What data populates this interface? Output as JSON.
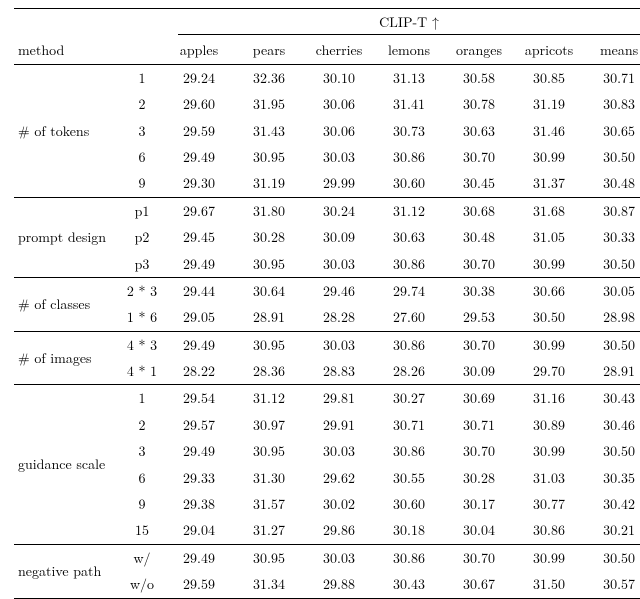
{
  "header": {
    "method_col": "method",
    "metric": "CLIP-T ↑",
    "columns": [
      "apples",
      "pears",
      "cherries",
      "lemons",
      "oranges",
      "apricots",
      "means"
    ]
  },
  "chart_data": {
    "type": "table",
    "title": "CLIP-T ↑",
    "columns": [
      "apples",
      "pears",
      "cherries",
      "lemons",
      "oranges",
      "apricots",
      "means"
    ],
    "groups": [
      {
        "name": "# of tokens",
        "rows": [
          {
            "variant": "1",
            "vals": [
              "29.24",
              "32.36",
              "30.10",
              "31.13",
              "30.58",
              "30.85",
              "30.71"
            ]
          },
          {
            "variant": "2",
            "vals": [
              "29.60",
              "31.95",
              "30.06",
              "31.41",
              "30.78",
              "31.19",
              "30.83"
            ]
          },
          {
            "variant": "3",
            "vals": [
              "29.59",
              "31.43",
              "30.06",
              "30.73",
              "30.63",
              "31.46",
              "30.65"
            ]
          },
          {
            "variant": "6",
            "vals": [
              "29.49",
              "30.95",
              "30.03",
              "30.86",
              "30.70",
              "30.99",
              "30.50"
            ]
          },
          {
            "variant": "9",
            "vals": [
              "29.30",
              "31.19",
              "29.99",
              "30.60",
              "30.45",
              "31.37",
              "30.48"
            ]
          }
        ]
      },
      {
        "name": "prompt design",
        "rows": [
          {
            "variant": "p1",
            "vals": [
              "29.67",
              "31.80",
              "30.24",
              "31.12",
              "30.68",
              "31.68",
              "30.87"
            ]
          },
          {
            "variant": "p2",
            "vals": [
              "29.45",
              "30.28",
              "30.09",
              "30.63",
              "30.48",
              "31.05",
              "30.33"
            ]
          },
          {
            "variant": "p3",
            "vals": [
              "29.49",
              "30.95",
              "30.03",
              "30.86",
              "30.70",
              "30.99",
              "30.50"
            ]
          }
        ]
      },
      {
        "name": "# of classes",
        "rows": [
          {
            "variant": "2 * 3",
            "vals": [
              "29.44",
              "30.64",
              "29.46",
              "29.74",
              "30.38",
              "30.66",
              "30.05"
            ]
          },
          {
            "variant": "1 * 6",
            "vals": [
              "29.05",
              "28.91",
              "28.28",
              "27.60",
              "29.53",
              "30.50",
              "28.98"
            ]
          }
        ]
      },
      {
        "name": "# of images",
        "rows": [
          {
            "variant": "4 * 3",
            "vals": [
              "29.49",
              "30.95",
              "30.03",
              "30.86",
              "30.70",
              "30.99",
              "30.50"
            ]
          },
          {
            "variant": "4 * 1",
            "vals": [
              "28.22",
              "28.36",
              "28.83",
              "28.26",
              "30.09",
              "29.70",
              "28.91"
            ]
          }
        ]
      },
      {
        "name": "guidance scale",
        "rows": [
          {
            "variant": "1",
            "vals": [
              "29.54",
              "31.12",
              "29.81",
              "30.27",
              "30.69",
              "31.16",
              "30.43"
            ]
          },
          {
            "variant": "2",
            "vals": [
              "29.57",
              "30.97",
              "29.91",
              "30.71",
              "30.71",
              "30.89",
              "30.46"
            ]
          },
          {
            "variant": "3",
            "vals": [
              "29.49",
              "30.95",
              "30.03",
              "30.86",
              "30.70",
              "30.99",
              "30.50"
            ]
          },
          {
            "variant": "6",
            "vals": [
              "29.33",
              "31.30",
              "29.62",
              "30.55",
              "30.28",
              "31.03",
              "30.35"
            ]
          },
          {
            "variant": "9",
            "vals": [
              "29.38",
              "31.57",
              "30.02",
              "30.60",
              "30.17",
              "30.77",
              "30.42"
            ]
          },
          {
            "variant": "15",
            "vals": [
              "29.04",
              "31.27",
              "29.86",
              "30.18",
              "30.04",
              "30.86",
              "30.21"
            ]
          }
        ]
      },
      {
        "name": "negative path",
        "rows": [
          {
            "variant": "w/",
            "vals": [
              "29.49",
              "30.95",
              "30.03",
              "30.86",
              "30.70",
              "30.99",
              "30.50"
            ]
          },
          {
            "variant": "w/o",
            "vals": [
              "29.59",
              "31.34",
              "29.88",
              "30.43",
              "30.67",
              "31.50",
              "30.57"
            ]
          }
        ]
      }
    ]
  }
}
